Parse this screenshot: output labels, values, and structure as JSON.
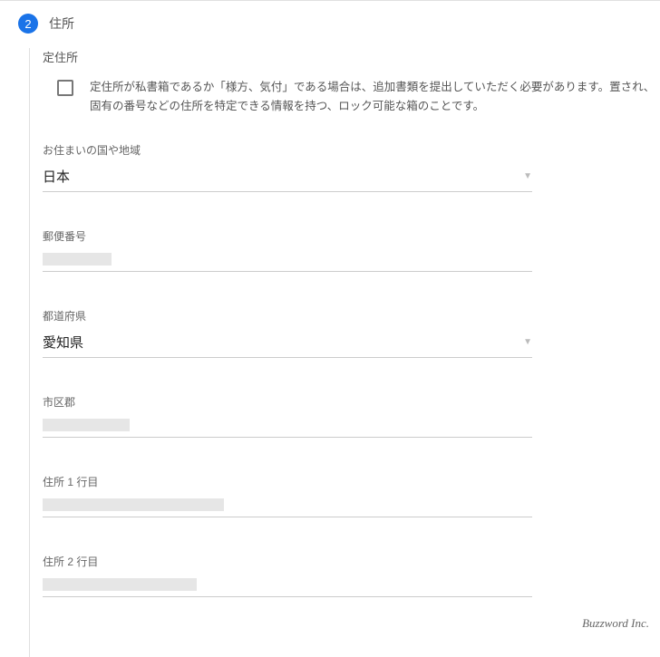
{
  "step": {
    "number": "2",
    "title": "住所"
  },
  "permanentAddress": {
    "label": "定住所",
    "checkboxText": "定住所が私書箱であるか「様方、気付」である場合は、追加書類を提出していただく必要があります。置され、固有の番号などの住所を特定できる情報を持つ、ロック可能な箱のことです。"
  },
  "fields": {
    "country": {
      "label": "お住まいの国や地域",
      "value": "日本"
    },
    "postal": {
      "label": "郵便番号"
    },
    "prefecture": {
      "label": "都道府県",
      "value": "愛知県"
    },
    "city": {
      "label": "市区郡"
    },
    "line1": {
      "label": "住所 1 行目"
    },
    "line2": {
      "label": "住所 2 行目"
    }
  },
  "watermark": "Buzzword Inc."
}
